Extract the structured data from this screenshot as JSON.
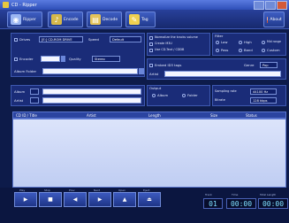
{
  "window": {
    "title": "CD - Ripper"
  },
  "toolbar": {
    "ripper_label": "Ripper",
    "encode_label": "Encode",
    "decode_label": "Decode",
    "tag_label": "Tag",
    "about_label": "About"
  },
  "source": {
    "drive_label": "Drives",
    "drive_value": "[E:] CD-ROM DRIVE",
    "speed_label": "Speed",
    "speed_value": "Default",
    "encoder_label": "Encoder",
    "quality_label": "Quality",
    "quality_value": "Stereo",
    "album_folder_label": "Album Folder"
  },
  "options": {
    "opt1": "Normalize the tracks volume",
    "opt2": "Create M3U",
    "opt3": "Use CD-Text / CDDB"
  },
  "filter": {
    "label": "Filter",
    "r1": "Low",
    "r2": "High",
    "r3": "Mid range",
    "r4": "Pass",
    "r5": "Band",
    "r6": "Custom"
  },
  "tags": {
    "artist_label": "Artist",
    "album_label": "Album",
    "id3_label": "Embed ID3 tags",
    "genre_label": "Genre",
    "genre_value": "Pop"
  },
  "output": {
    "label": "Output",
    "r1": "Album",
    "r2": "Folder",
    "sampling_label": "Sampling rate",
    "sampling_value": "44100 Hz",
    "bitrate_label": "Bitrate",
    "bitrate_value": "128 kbps"
  },
  "list": {
    "columns": [
      "CD ID / Title",
      "Artist",
      "Length",
      "Size",
      "Status"
    ]
  },
  "controls": {
    "labels": [
      "Play",
      "Stop",
      "Prev",
      "Next",
      "Open",
      "Eject"
    ],
    "glyphs": [
      "▶",
      "■",
      "◀",
      "▶",
      "▲",
      "⏏"
    ]
  },
  "displays": {
    "track_label": "Track",
    "track_value": "01",
    "time_label": "Time",
    "time_value": "00:00",
    "total_label": "Total Length",
    "total_value": "00:00"
  }
}
